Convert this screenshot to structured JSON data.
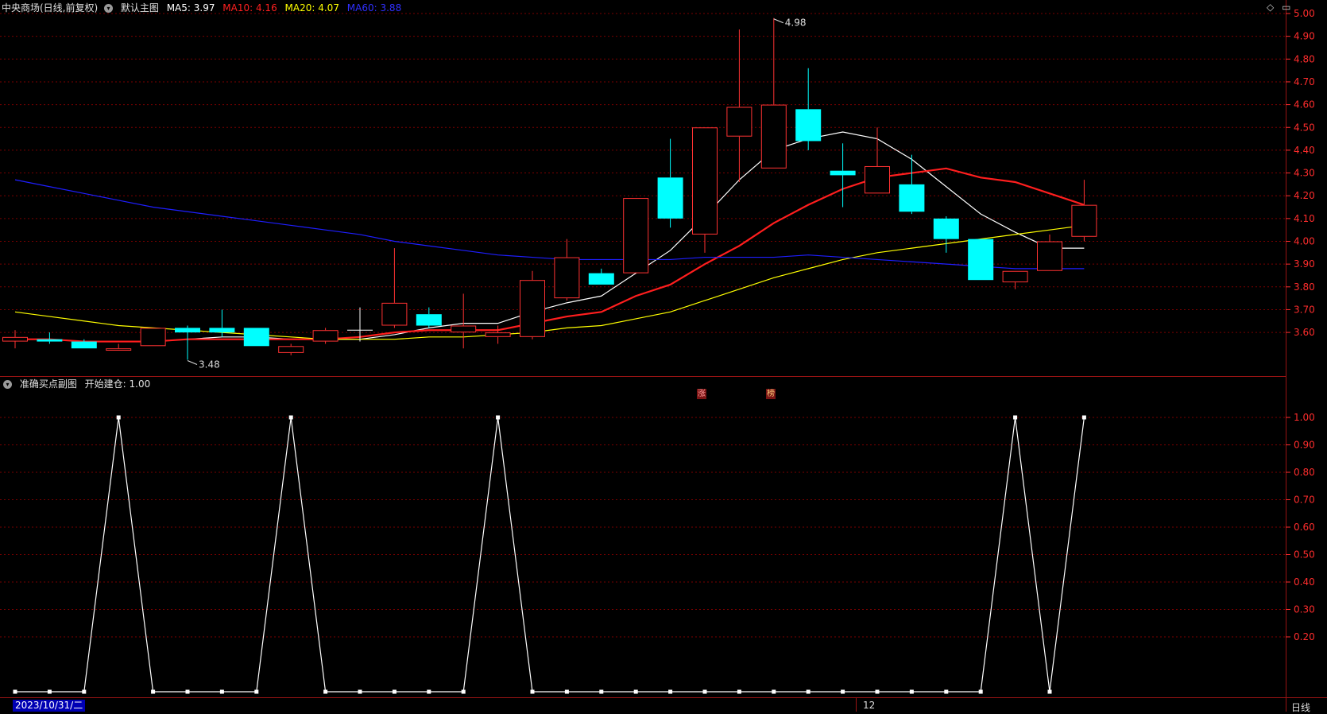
{
  "header": {
    "stock_title": "中央商场(日线,前复权)",
    "main_chart_label": "默认主图",
    "ma5": "MA5: 3.97",
    "ma10": "MA10: 4.16",
    "ma20": "MA20: 4.07",
    "ma60": "MA60: 3.88"
  },
  "sub_header": {
    "indicator_label": "准确买点副图",
    "value_text": "开始建仓: 1.00"
  },
  "toolbar": {
    "diamond_icon": "diamond-icon",
    "window_icon": "maximize-icon"
  },
  "footer": {
    "date_label": "2023/10/31/二",
    "month_label": "12",
    "period_label": "日线"
  },
  "events": {
    "up_badge": "涨",
    "rank_badge": "榜"
  },
  "colors": {
    "up": "#ff3232",
    "down": "#00ffff",
    "ma5": "#ffffff",
    "ma10": "#ff1e1e",
    "ma20": "#ffff00",
    "ma60": "#1e1eff",
    "grid": "#7a0000",
    "axis_text": "#ff2d2d"
  },
  "chart_data": [
    {
      "type": "candlestick",
      "title": "中央商场(日线,前复权)",
      "y_ticks": [
        5.0,
        4.9,
        4.8,
        4.7,
        4.6,
        4.5,
        4.4,
        4.3,
        4.2,
        4.1,
        4.0,
        3.9,
        3.8,
        3.7,
        3.6
      ],
      "ylim": [
        3.45,
        5.01
      ],
      "grid": true,
      "annotations": [
        {
          "text": "4.98",
          "index": 22,
          "value": 4.98
        },
        {
          "text": "3.48",
          "index": 5,
          "value": 3.48
        }
      ],
      "candles": [
        {
          "o": 3.56,
          "c": 3.58,
          "h": 3.61,
          "l": 3.53
        },
        {
          "o": 3.57,
          "c": 3.56,
          "h": 3.6,
          "l": 3.55
        },
        {
          "o": 3.56,
          "c": 3.53,
          "h": 3.57,
          "l": 3.53
        },
        {
          "o": 3.52,
          "c": 3.53,
          "h": 3.55,
          "l": 3.52
        },
        {
          "o": 3.54,
          "c": 3.62,
          "h": 3.62,
          "l": 3.54
        },
        {
          "o": 3.62,
          "c": 3.6,
          "h": 3.63,
          "l": 3.48
        },
        {
          "o": 3.62,
          "c": 3.6,
          "h": 3.7,
          "l": 3.58
        },
        {
          "o": 3.62,
          "c": 3.54,
          "h": 3.62,
          "l": 3.54
        },
        {
          "o": 3.51,
          "c": 3.54,
          "h": 3.55,
          "l": 3.5
        },
        {
          "o": 3.56,
          "c": 3.61,
          "h": 3.62,
          "l": 3.55
        },
        {
          "o": 3.61,
          "c": 3.61,
          "h": 3.71,
          "l": 3.56
        },
        {
          "o": 3.63,
          "c": 3.73,
          "h": 3.97,
          "l": 3.62
        },
        {
          "o": 3.68,
          "c": 3.63,
          "h": 3.71,
          "l": 3.62
        },
        {
          "o": 3.6,
          "c": 3.63,
          "h": 3.77,
          "l": 3.53
        },
        {
          "o": 3.58,
          "c": 3.6,
          "h": 3.63,
          "l": 3.55
        },
        {
          "o": 3.58,
          "c": 3.83,
          "h": 3.87,
          "l": 3.57
        },
        {
          "o": 3.75,
          "c": 3.93,
          "h": 4.01,
          "l": 3.74
        },
        {
          "o": 3.86,
          "c": 3.81,
          "h": 3.88,
          "l": 3.81
        },
        {
          "o": 3.86,
          "c": 4.19,
          "h": 4.19,
          "l": 3.86
        },
        {
          "o": 4.28,
          "c": 4.1,
          "h": 4.45,
          "l": 4.06
        },
        {
          "o": 4.03,
          "c": 4.5,
          "h": 4.5,
          "l": 3.95
        },
        {
          "o": 4.46,
          "c": 4.59,
          "h": 4.93,
          "l": 4.26
        },
        {
          "o": 4.32,
          "c": 4.6,
          "h": 4.98,
          "l": 4.32
        },
        {
          "o": 4.58,
          "c": 4.44,
          "h": 4.76,
          "l": 4.4
        },
        {
          "o": 4.31,
          "c": 4.29,
          "h": 4.43,
          "l": 4.15
        },
        {
          "o": 4.21,
          "c": 4.33,
          "h": 4.5,
          "l": 4.21
        },
        {
          "o": 4.25,
          "c": 4.13,
          "h": 4.38,
          "l": 4.12
        },
        {
          "o": 4.1,
          "c": 4.01,
          "h": 4.11,
          "l": 3.95
        },
        {
          "o": 4.01,
          "c": 3.83,
          "h": 4.01,
          "l": 3.83
        },
        {
          "o": 3.82,
          "c": 3.87,
          "h": 3.87,
          "l": 3.79
        },
        {
          "o": 3.87,
          "c": 4.0,
          "h": 4.03,
          "l": 3.87
        },
        {
          "o": 4.02,
          "c": 4.16,
          "h": 4.27,
          "l": 4.0
        }
      ],
      "series": [
        {
          "name": "MA5",
          "color": "#ffffff",
          "values": [
            3.57,
            3.57,
            3.56,
            3.56,
            3.56,
            3.57,
            3.58,
            3.58,
            3.57,
            3.57,
            3.57,
            3.59,
            3.62,
            3.64,
            3.64,
            3.69,
            3.73,
            3.76,
            3.86,
            3.96,
            4.11,
            4.27,
            4.4,
            4.45,
            4.48,
            4.45,
            4.36,
            4.24,
            4.12,
            4.04,
            3.97,
            3.97
          ]
        },
        {
          "name": "MA10",
          "color": "#ff1e1e",
          "values": [
            3.57,
            3.57,
            3.56,
            3.56,
            3.56,
            3.57,
            3.57,
            3.57,
            3.57,
            3.57,
            3.58,
            3.6,
            3.61,
            3.61,
            3.61,
            3.64,
            3.67,
            3.69,
            3.76,
            3.81,
            3.9,
            3.98,
            4.08,
            4.16,
            4.23,
            4.28,
            4.3,
            4.32,
            4.28,
            4.26,
            4.21,
            4.16
          ]
        },
        {
          "name": "MA20",
          "color": "#ffff00",
          "values": [
            3.69,
            3.67,
            3.65,
            3.63,
            3.62,
            3.61,
            3.6,
            3.59,
            3.58,
            3.57,
            3.57,
            3.57,
            3.58,
            3.58,
            3.59,
            3.6,
            3.62,
            3.63,
            3.66,
            3.69,
            3.74,
            3.79,
            3.84,
            3.88,
            3.92,
            3.95,
            3.97,
            3.99,
            4.01,
            4.03,
            4.05,
            4.07
          ]
        },
        {
          "name": "MA60",
          "color": "#1e1eff",
          "values": [
            4.27,
            4.24,
            4.21,
            4.18,
            4.15,
            4.13,
            4.11,
            4.09,
            4.07,
            4.05,
            4.03,
            4.0,
            3.98,
            3.96,
            3.94,
            3.93,
            3.92,
            3.92,
            3.92,
            3.92,
            3.93,
            3.93,
            3.93,
            3.94,
            3.93,
            3.92,
            3.91,
            3.9,
            3.89,
            3.88,
            3.88,
            3.88
          ]
        }
      ]
    },
    {
      "type": "line",
      "title": "准确买点副图",
      "y_ticks": [
        1.0,
        0.9,
        0.8,
        0.7,
        0.6,
        0.5,
        0.4,
        0.3,
        0.2
      ],
      "ylim": [
        0.0,
        1.0
      ],
      "grid": true,
      "series": [
        {
          "name": "开始建仓",
          "color": "#ffffff",
          "values": [
            0,
            0,
            0,
            1,
            0,
            0,
            0,
            0,
            1,
            0,
            0,
            0,
            0,
            0,
            1,
            0,
            0,
            0,
            0,
            0,
            0,
            0,
            0,
            0,
            0,
            0,
            0,
            0,
            0,
            1,
            0,
            1
          ]
        }
      ]
    }
  ]
}
